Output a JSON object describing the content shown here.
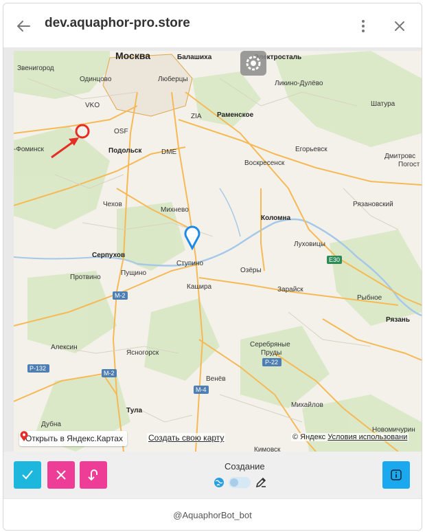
{
  "header": {
    "title": "dev.aquaphor-pro.store",
    "back_icon": "arrow-left-icon",
    "menu_icon": "kebab-menu-icon",
    "close_icon": "close-icon"
  },
  "map": {
    "cities": {
      "moscow": "Москва",
      "balashikha": "Балашиха",
      "elektrostal": "Электросталь",
      "zvenigorod": "Звенигород",
      "odintsovo": "Одинцово",
      "lyubertsy": "Люберцы",
      "likino": "Ликино-Дулёво",
      "vko": "VKO",
      "zia": "ZIA",
      "ramenskoe": "Раменское",
      "shatura": "Шатура",
      "osf": "OSF",
      "fominsk": "-Фоминск",
      "podolsk": "Подольск",
      "dme": "DME",
      "egorievsk": "Егорьевск",
      "dmitrovsky": "Дмитровс",
      "pogost": "Погост",
      "voskresensk": "Воскресенск",
      "chekhov": "Чехов",
      "mikhnevo": "Михнево",
      "ryazanovsky": "Рязановский",
      "kolomna": "Коломна",
      "lukhovitsy": "Луховицы",
      "serpukhov": "Серпухов",
      "stupino": "Ступино",
      "protvino": "Протвино",
      "pushchino": "Пущино",
      "ozyory": "Озёры",
      "kashira": "Кашира",
      "zaraisk": "Зарайск",
      "rybnoe": "Рыбное",
      "ryazan": "Рязань",
      "aleksin": "Алексин",
      "yasnogorsk": "Ясногорск",
      "serebryanye": "Серебряные",
      "prudy": "Пруды",
      "venev": "Венёв",
      "tula": "Тула",
      "mikhailov": "Михайлов",
      "dubna": "Дубна",
      "novomichurinsk": "Новомичурин",
      "kimovsk": "Кимовск"
    },
    "road_labels": [
      "M-2",
      "M-2",
      "P-132",
      "M-4",
      "P-22",
      "E30"
    ],
    "open_in_yandex": "Открыть в Яндекс.Картах",
    "create_map": "Создать свою карту",
    "copyright_prefix": "© Яндекс",
    "terms": "Условия использовани",
    "settings_icon": "gear-icon",
    "location_pin_icon": "map-pin-icon"
  },
  "toolbar": {
    "confirm_icon": "checkmark-icon",
    "cancel_icon": "close-x-icon",
    "undo_icon": "undo-arrow-icon",
    "mode_label": "Создание",
    "globe_icon": "globe-icon",
    "edit_icon": "pencil-icon",
    "info_icon": "info-icon",
    "colors": {
      "confirm": "#1db7de",
      "cancel": "#ee3d96",
      "undo": "#ee3d96",
      "info": "#1aa8ee"
    }
  },
  "footer": {
    "bot_name": "@AquaphorBot_bot"
  }
}
